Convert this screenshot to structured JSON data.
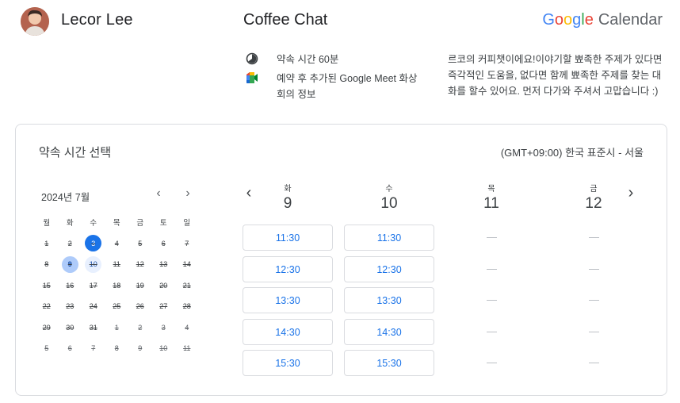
{
  "header": {
    "host_name": "Lecor Lee",
    "event_title": "Coffee Chat",
    "brand_letters": [
      "G",
      "o",
      "o",
      "g",
      "l",
      "e"
    ],
    "brand_product": "Calendar"
  },
  "info": {
    "duration": "약속 시간 60분",
    "meet_info": "예약 후 추가된 Google Meet 화상 회의 정보",
    "description": "르코의 커피챗이에요!이야기할 뾰족한 주제가 있다면 즉각적인 도움을, 없다면 함께 뾰족한 주제를 찾는 대화를 할수 있어요. 먼저 다가와 주셔서 고맙습니다 :)"
  },
  "booking": {
    "title": "약속 시간 선택",
    "timezone": "(GMT+09:00) 한국 표준시 - 서울"
  },
  "mini_calendar": {
    "month": "2024년 7월",
    "weekdays": [
      "월",
      "화",
      "수",
      "목",
      "금",
      "토",
      "일"
    ],
    "weeks": [
      [
        "1",
        "2",
        "3",
        "4",
        "5",
        "6",
        "7"
      ],
      [
        "8",
        "9",
        "10",
        "11",
        "12",
        "13",
        "14"
      ],
      [
        "15",
        "16",
        "17",
        "18",
        "19",
        "20",
        "21"
      ],
      [
        "22",
        "23",
        "24",
        "25",
        "26",
        "27",
        "28"
      ],
      [
        "29",
        "30",
        "31",
        "1",
        "2",
        "3",
        "4"
      ],
      [
        "5",
        "6",
        "7",
        "8",
        "9",
        "10",
        "11"
      ]
    ],
    "today": "3",
    "selected": "9",
    "available": "10"
  },
  "week": {
    "days": [
      {
        "dow": "화",
        "num": "9",
        "slots": [
          "11:30",
          "12:30",
          "13:30",
          "14:30",
          "15:30"
        ]
      },
      {
        "dow": "수",
        "num": "10",
        "slots": [
          "11:30",
          "12:30",
          "13:30",
          "14:30",
          "15:30"
        ]
      },
      {
        "dow": "목",
        "num": "11",
        "slots": []
      },
      {
        "dow": "금",
        "num": "12",
        "slots": []
      }
    ],
    "empty_rows": 5
  },
  "colors": {
    "accent": "#1a73e8",
    "selected_bg": "#aecbfa",
    "border": "#dadce0"
  },
  "icons": {
    "duration": "clock-icon",
    "meet": "google-meet-icon",
    "prev": "chevron-left-icon",
    "next": "chevron-right-icon"
  }
}
